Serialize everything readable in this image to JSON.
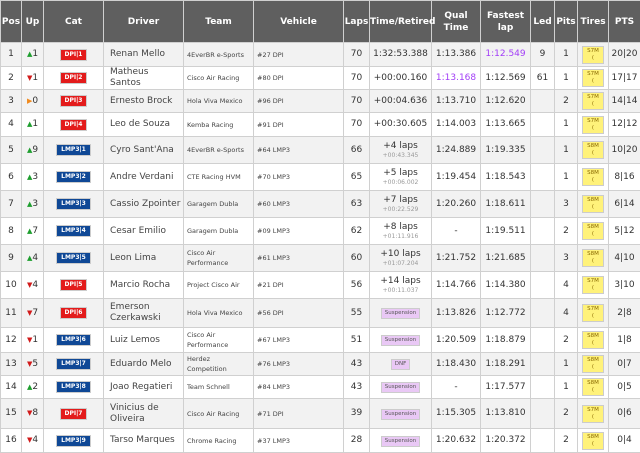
{
  "headers": [
    "Pos",
    "Up",
    "Cat",
    "Driver",
    "Team",
    "Vehicle",
    "Laps",
    "Time/Retired",
    "Qual Time",
    "Fastest lap",
    "Led",
    "Pits",
    "Tires",
    "PTS"
  ],
  "colors": {
    "dpi": "#e31b1b",
    "lmp3": "#0f4896",
    "up": "#1e9e2e",
    "down": "#d11a1a",
    "same": "#f08a1e",
    "best": "#a23ef7",
    "suspension": "#e9c8f5",
    "tire": "#fff27a"
  },
  "rows": [
    {
      "pos": "1",
      "dir": "up",
      "up": "1",
      "cls": "dpi",
      "cat": "DPI|1",
      "driver": "Renan Mello",
      "team": "4EverBR e-Sports",
      "vehicle": "#27 DPI",
      "laps": "70",
      "time": "1:32:53.388",
      "time_sub": "",
      "status": "",
      "qual": "1:13.386",
      "qual_best": false,
      "fast": "1:12.549",
      "fast_best": true,
      "led": "9",
      "pits": "1",
      "tire": "S7M",
      "tire_sub": "(",
      "pts": "20|20"
    },
    {
      "pos": "2",
      "dir": "down",
      "up": "1",
      "cls": "dpi",
      "cat": "DPI|2",
      "driver": "Matheus Santos",
      "team": "Cisco Air Racing",
      "vehicle": "#80 DPI",
      "laps": "70",
      "time": "+00:00.160",
      "time_sub": "",
      "status": "",
      "qual": "1:13.168",
      "qual_best": true,
      "fast": "1:12.569",
      "fast_best": false,
      "led": "61",
      "pits": "1",
      "tire": "S7M",
      "tire_sub": "(",
      "pts": "17|17"
    },
    {
      "pos": "3",
      "dir": "same",
      "up": "0",
      "cls": "dpi",
      "cat": "DPI|3",
      "driver": "Ernesto Brock",
      "team": "Hola Viva Mexico",
      "vehicle": "#96 DPI",
      "laps": "70",
      "time": "+00:04.636",
      "time_sub": "",
      "status": "",
      "qual": "1:13.710",
      "qual_best": false,
      "fast": "1:12.620",
      "fast_best": false,
      "led": "",
      "pits": "2",
      "tire": "S7M",
      "tire_sub": "(",
      "pts": "14|14"
    },
    {
      "pos": "4",
      "dir": "up",
      "up": "1",
      "cls": "dpi",
      "cat": "DPI|4",
      "driver": "Leo de Souza",
      "team": "Kemba Racing",
      "vehicle": "#91 DPI",
      "laps": "70",
      "time": "+00:30.605",
      "time_sub": "",
      "status": "",
      "qual": "1:14.003",
      "qual_best": false,
      "fast": "1:13.665",
      "fast_best": false,
      "led": "",
      "pits": "1",
      "tire": "S7M",
      "tire_sub": "(",
      "pts": "12|12"
    },
    {
      "pos": "5",
      "dir": "up",
      "up": "9",
      "cls": "lmp3",
      "cat": "LMP3|1",
      "driver": "Cyro Sant'Ana",
      "team": "4EverBR e-Sports",
      "vehicle": "#64 LMP3",
      "laps": "66",
      "time": "+4 laps",
      "time_sub": "+00:43.345",
      "status": "",
      "qual": "1:24.889",
      "qual_best": false,
      "fast": "1:19.335",
      "fast_best": false,
      "led": "",
      "pits": "1",
      "tire": "S8M",
      "tire_sub": "(",
      "pts": "10|20"
    },
    {
      "pos": "6",
      "dir": "up",
      "up": "3",
      "cls": "lmp3",
      "cat": "LMP3|2",
      "driver": "Andre Verdani",
      "team": "CTE Racing HVM",
      "vehicle": "#70 LMP3",
      "laps": "65",
      "time": "+5 laps",
      "time_sub": "+00:06.002",
      "status": "",
      "qual": "1:19.454",
      "qual_best": false,
      "fast": "1:18.543",
      "fast_best": false,
      "led": "",
      "pits": "1",
      "tire": "S8M",
      "tire_sub": "(",
      "pts": "8|16"
    },
    {
      "pos": "7",
      "dir": "up",
      "up": "3",
      "cls": "lmp3",
      "cat": "LMP3|3",
      "driver": "Cassio Zpointer",
      "team": "Garagem Dubla",
      "vehicle": "#60 LMP3",
      "laps": "63",
      "time": "+7 laps",
      "time_sub": "+00:22.529",
      "status": "",
      "qual": "1:20.260",
      "qual_best": false,
      "fast": "1:18.611",
      "fast_best": false,
      "led": "",
      "pits": "3",
      "tire": "S8M",
      "tire_sub": "(",
      "pts": "6|14"
    },
    {
      "pos": "8",
      "dir": "up",
      "up": "7",
      "cls": "lmp3",
      "cat": "LMP3|4",
      "driver": "Cesar Emilio",
      "team": "Garagem Dubla",
      "vehicle": "#09 LMP3",
      "laps": "62",
      "time": "+8 laps",
      "time_sub": "+01:11.916",
      "status": "",
      "qual": "-",
      "qual_best": false,
      "fast": "1:19.511",
      "fast_best": false,
      "led": "",
      "pits": "2",
      "tire": "S8M",
      "tire_sub": "(",
      "pts": "5|12"
    },
    {
      "pos": "9",
      "dir": "up",
      "up": "4",
      "cls": "lmp3",
      "cat": "LMP3|5",
      "driver": "Leon Lima",
      "team": "Cisco Air Performance",
      "vehicle": "#61 LMP3",
      "laps": "60",
      "time": "+10 laps",
      "time_sub": "+01:07.204",
      "status": "",
      "qual": "1:21.752",
      "qual_best": false,
      "fast": "1:21.685",
      "fast_best": false,
      "led": "",
      "pits": "3",
      "tire": "S8M",
      "tire_sub": "(",
      "pts": "4|10"
    },
    {
      "pos": "10",
      "dir": "down",
      "up": "4",
      "cls": "dpi",
      "cat": "DPI|5",
      "driver": "Marcio Rocha",
      "team": "Project Cisco Air",
      "vehicle": "#21 DPI",
      "laps": "56",
      "time": "+14 laps",
      "time_sub": "+00:11.037",
      "status": "",
      "qual": "1:14.766",
      "qual_best": false,
      "fast": "1:14.380",
      "fast_best": false,
      "led": "",
      "pits": "4",
      "tire": "S7M",
      "tire_sub": "(",
      "pts": "3|10"
    },
    {
      "pos": "11",
      "dir": "down",
      "up": "7",
      "cls": "dpi",
      "cat": "DPI|6",
      "driver": "Emerson Czerkawski",
      "team": "Hola Viva Mexico",
      "vehicle": "#56 DPI",
      "laps": "55",
      "time": "",
      "time_sub": "",
      "status": "Suspension",
      "qual": "1:13.826",
      "qual_best": false,
      "fast": "1:12.772",
      "fast_best": false,
      "led": "",
      "pits": "4",
      "tire": "S7M",
      "tire_sub": "(",
      "pts": "2|8"
    },
    {
      "pos": "12",
      "dir": "down",
      "up": "1",
      "cls": "lmp3",
      "cat": "LMP3|6",
      "driver": "Luiz Lemos",
      "team": "Cisco Air Performance",
      "vehicle": "#67 LMP3",
      "laps": "51",
      "time": "",
      "time_sub": "",
      "status": "Suspension",
      "qual": "1:20.509",
      "qual_best": false,
      "fast": "1:18.879",
      "fast_best": false,
      "led": "",
      "pits": "2",
      "tire": "S8M",
      "tire_sub": "(",
      "pts": "1|8"
    },
    {
      "pos": "13",
      "dir": "down",
      "up": "5",
      "cls": "lmp3",
      "cat": "LMP3|7",
      "driver": "Eduardo Melo",
      "team": "Herdez Competition",
      "vehicle": "#76 LMP3",
      "laps": "43",
      "time": "",
      "time_sub": "",
      "status": "DNF",
      "qual": "1:18.430",
      "qual_best": false,
      "fast": "1:18.291",
      "fast_best": false,
      "led": "",
      "pits": "1",
      "tire": "S8M",
      "tire_sub": "(",
      "pts": "0|7"
    },
    {
      "pos": "14",
      "dir": "up",
      "up": "2",
      "cls": "lmp3",
      "cat": "LMP3|8",
      "driver": "Joao Regatieri",
      "team": "Team Schnell",
      "vehicle": "#84 LMP3",
      "laps": "43",
      "time": "",
      "time_sub": "",
      "status": "Suspension",
      "qual": "-",
      "qual_best": false,
      "fast": "1:17.577",
      "fast_best": false,
      "led": "",
      "pits": "1",
      "tire": "S8M",
      "tire_sub": "(",
      "pts": "0|5"
    },
    {
      "pos": "15",
      "dir": "down",
      "up": "8",
      "cls": "dpi",
      "cat": "DPI|7",
      "driver": "Vinicius de Oliveira",
      "team": "Cisco Air Racing",
      "vehicle": "#71 DPI",
      "laps": "39",
      "time": "",
      "time_sub": "",
      "status": "Suspension",
      "qual": "1:15.305",
      "qual_best": false,
      "fast": "1:13.810",
      "fast_best": false,
      "led": "",
      "pits": "2",
      "tire": "S7M",
      "tire_sub": "(",
      "pts": "0|6"
    },
    {
      "pos": "16",
      "dir": "down",
      "up": "4",
      "cls": "lmp3",
      "cat": "LMP3|9",
      "driver": "Tarso Marques",
      "team": "Chrome Racing",
      "vehicle": "#37 LMP3",
      "laps": "28",
      "time": "",
      "time_sub": "",
      "status": "Suspension",
      "qual": "1:20.632",
      "qual_best": false,
      "fast": "1:20.372",
      "fast_best": false,
      "led": "",
      "pits": "2",
      "tire": "S8M",
      "tire_sub": "(",
      "pts": "0|4"
    }
  ]
}
